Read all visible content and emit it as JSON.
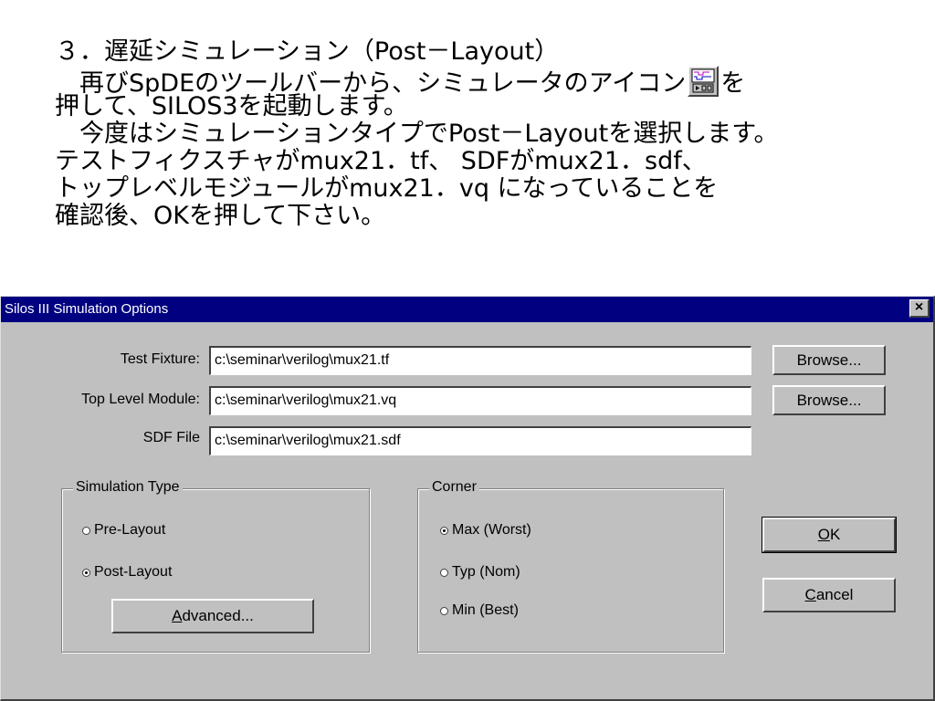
{
  "slide": {
    "line1": "３．遅延シミュレーション（Post－Layout）",
    "line2a": "　再びSpDEのツールバーから、シミュレータのアイコン",
    "line2b": "を",
    "line3": "押して、SILOS3を起動します。",
    "line4": "　今度はシミュレーションタイプでPost－Layoutを選択します。",
    "line5": "テストフィクスチャがmux21．tf、 SDFがmux21．sdf、",
    "line6": "トップレベルモジュールがmux21．vq  になっていることを",
    "line7": "確認後、OKを押して下さい。",
    "icon": "simulator-icon"
  },
  "dialog": {
    "title": "Silos III Simulation Options",
    "close_label": "×",
    "test_fixture_label": "Test Fixture:",
    "test_fixture_value": "c:\\seminar\\verilog\\mux21.tf",
    "top_level_label": "Top Level Module:",
    "top_level_value": "c:\\seminar\\verilog\\mux21.vq",
    "sdf_label": "SDF File",
    "sdf_value": "c:\\seminar\\verilog\\mux21.sdf",
    "browse_label": "Browse...",
    "sim_type": {
      "title": "Simulation Type",
      "pre_layout": "Pre-Layout",
      "post_layout": "Post-Layout",
      "selected": "Post-Layout",
      "advanced_underline": "A",
      "advanced_rest": "dvanced..."
    },
    "corner": {
      "title": "Corner",
      "max": "Max (Worst)",
      "typ": "Typ (Nom)",
      "min": "Min (Best)",
      "selected": "Max (Worst)"
    },
    "ok_underline": "O",
    "ok_rest": "K",
    "cancel_underline": "C",
    "cancel_rest": "ancel"
  }
}
